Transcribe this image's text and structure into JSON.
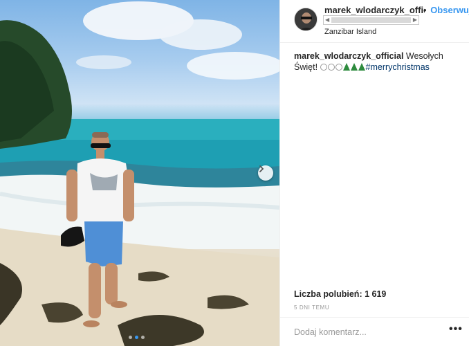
{
  "post": {
    "username": "marek_wlodarczyk_official",
    "follow_label": "Obserwuj",
    "separator": "•",
    "location": "Zanzibar Island",
    "caption_text": " Wesołych Święt!",
    "caption_hashtag": "#merrychristmas",
    "likes": "Liczba polubień: 1 619",
    "timestamp": "5 DNI TEMU",
    "comment_placeholder": "Dodaj komentarz...",
    "more_options": "•••"
  },
  "carousel": {
    "slide_count": 3,
    "active_index": 1
  },
  "colors": {
    "link": "#3897f0",
    "hashtag": "#003569",
    "muted": "#999999"
  },
  "icons": {
    "next": "chevron-right-icon",
    "more": "more-options-icon"
  }
}
